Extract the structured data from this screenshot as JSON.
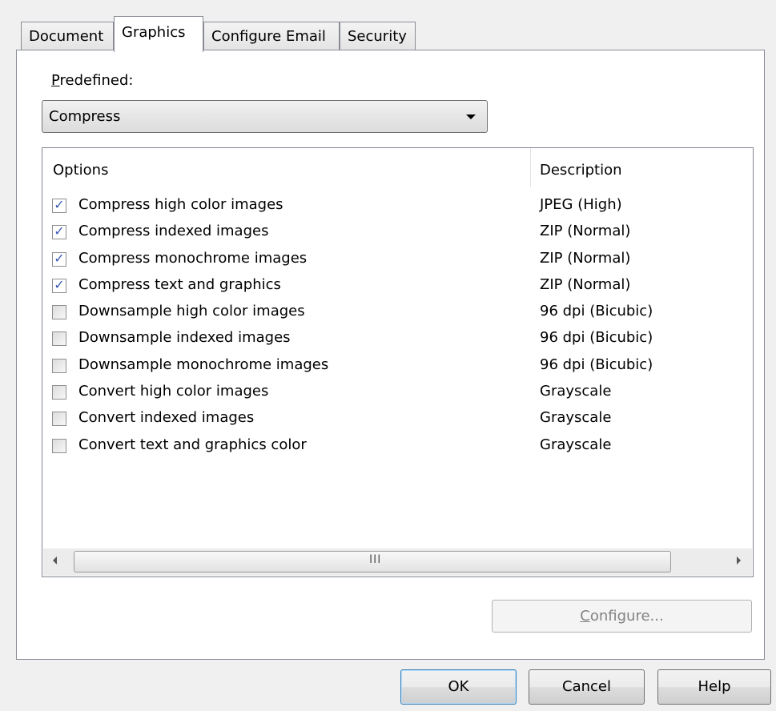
{
  "tabs": [
    {
      "label": "Document",
      "active": false
    },
    {
      "label": "Graphics",
      "active": true
    },
    {
      "label": "Configure Email",
      "active": false
    },
    {
      "label": "Security",
      "active": false
    }
  ],
  "predefined": {
    "label_accel": "P",
    "label_rest": "redefined:",
    "selected": "Compress"
  },
  "list": {
    "headers": {
      "options": "Options",
      "description": "Description"
    },
    "rows": [
      {
        "option": "Compress high color images",
        "description": "JPEG (High)",
        "checked": true
      },
      {
        "option": "Compress indexed images",
        "description": "ZIP (Normal)",
        "checked": true
      },
      {
        "option": "Compress monochrome images",
        "description": "ZIP (Normal)",
        "checked": true
      },
      {
        "option": "Compress text and graphics",
        "description": "ZIP (Normal)",
        "checked": true
      },
      {
        "option": "Downsample high color images",
        "description": "96 dpi (Bicubic)",
        "checked": false
      },
      {
        "option": "Downsample indexed images",
        "description": "96 dpi (Bicubic)",
        "checked": false
      },
      {
        "option": "Downsample monochrome images",
        "description": "96 dpi (Bicubic)",
        "checked": false
      },
      {
        "option": "Convert high color images",
        "description": "Grayscale",
        "checked": false
      },
      {
        "option": "Convert indexed images",
        "description": "Grayscale",
        "checked": false
      },
      {
        "option": "Convert text and graphics color",
        "description": "Grayscale",
        "checked": false
      }
    ],
    "scroll_grip": "III"
  },
  "configure": {
    "accel": "C",
    "rest": "onfigure...",
    "enabled": false
  },
  "buttons": {
    "ok": "OK",
    "cancel": "Cancel",
    "help": "Help"
  },
  "icons": {
    "check": "✓",
    "combo_arrow": "chevron-down-icon"
  }
}
